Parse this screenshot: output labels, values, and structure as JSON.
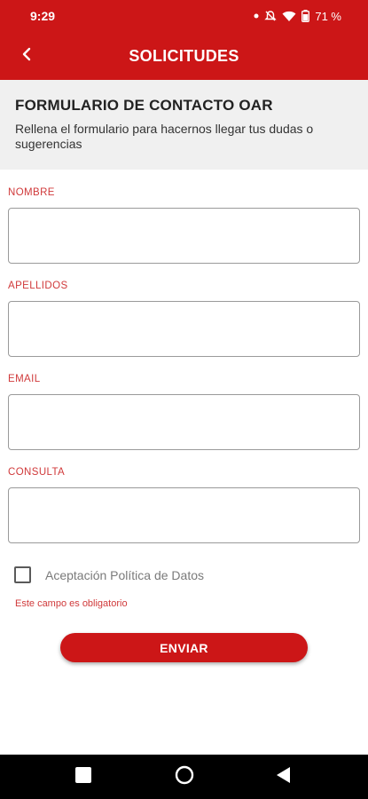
{
  "status_bar": {
    "time": "9:29",
    "battery_text": "71 %",
    "icons": [
      "dot-icon",
      "mute-icon",
      "wifi-icon",
      "battery-icon"
    ]
  },
  "app_bar": {
    "title": "SOLICITUDES",
    "back_icon": "chevron-left-icon"
  },
  "header": {
    "title": "FORMULARIO DE CONTACTO OAR",
    "subtitle": "Rellena el formulario para hacernos llegar tus dudas o sugerencias"
  },
  "form": {
    "fields": [
      {
        "label": "NOMBRE",
        "value": ""
      },
      {
        "label": "APELLIDOS",
        "value": ""
      },
      {
        "label": "EMAIL",
        "value": ""
      },
      {
        "label": "CONSULTA",
        "value": ""
      }
    ],
    "checkbox": {
      "label": "Aceptación Política de Datos",
      "checked": false
    },
    "error": "Este campo es obligatorio",
    "submit_label": "ENVIAR"
  },
  "nav_bar": {
    "icons": [
      "square-icon",
      "circle-icon",
      "triangle-back-icon"
    ]
  },
  "colors": {
    "brand": "#cc1617",
    "label": "#d0393a",
    "header_bg": "#f0f0f0"
  }
}
